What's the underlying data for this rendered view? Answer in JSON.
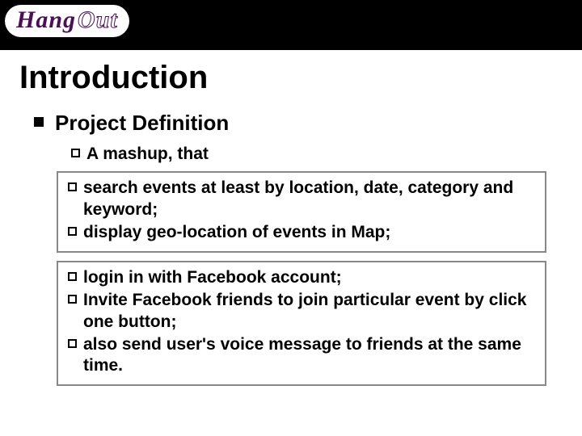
{
  "logo": {
    "part1": "Hang",
    "part2": "Out"
  },
  "title": "Introduction",
  "section": {
    "heading": "Project Definition",
    "intro": "A mashup, that",
    "box1": {
      "items": [
        "search events at least by location, date, category and keyword;",
        "display geo-location of events in Map;"
      ]
    },
    "box2": {
      "items": [
        "login in with Facebook account;",
        "Invite Facebook friends to join particular event by click one button;",
        "also send user's voice message to friends at the same time."
      ]
    }
  }
}
